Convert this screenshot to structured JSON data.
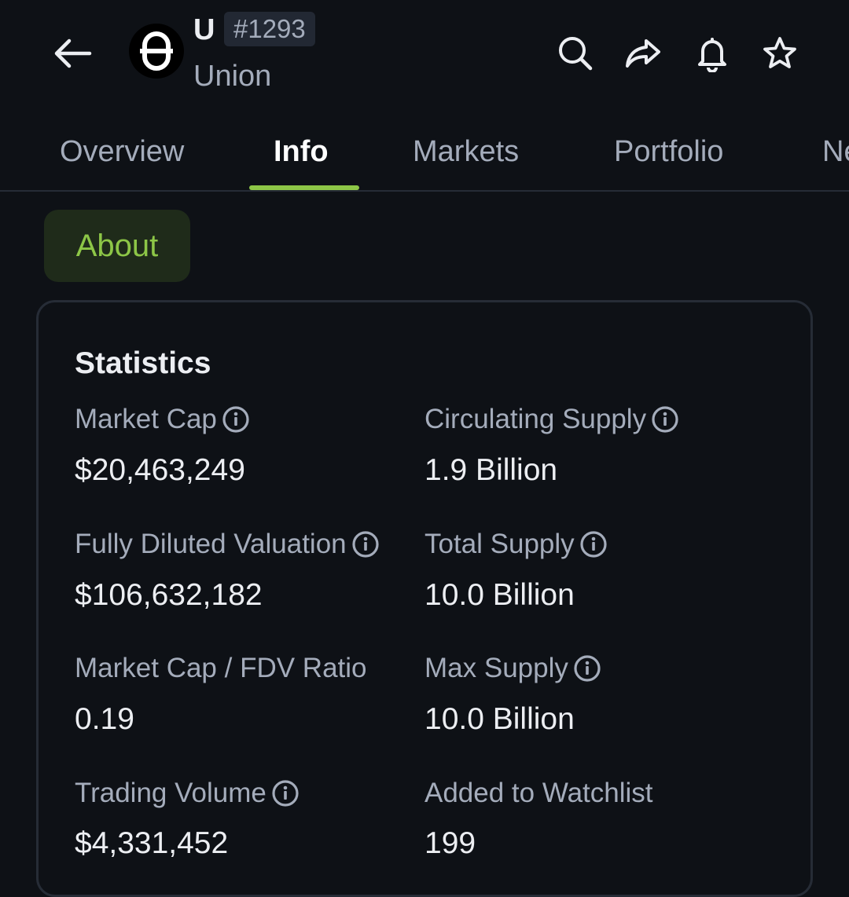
{
  "header": {
    "symbol": "U",
    "rank": "#1293",
    "name": "Union",
    "icons": [
      "back-arrow-icon",
      "search-icon",
      "share-icon",
      "bell-icon",
      "star-icon"
    ]
  },
  "tabs": [
    {
      "label": "Overview",
      "active": false
    },
    {
      "label": "Info",
      "active": true
    },
    {
      "label": "Markets",
      "active": false
    },
    {
      "label": "Portfolio",
      "active": false
    },
    {
      "label": "News",
      "active": false
    }
  ],
  "section_chip": "About",
  "statistics": {
    "title": "Statistics",
    "items": [
      {
        "label": "Market Cap",
        "value": "$20,463,249",
        "info": true
      },
      {
        "label": "Circulating Supply",
        "value": "1.9 Billion",
        "info": true
      },
      {
        "label": "Fully Diluted Valuation",
        "value": "$106,632,182",
        "info": true
      },
      {
        "label": "Total Supply",
        "value": "10.0 Billion",
        "info": true
      },
      {
        "label": "Market Cap / FDV Ratio",
        "value": "0.19",
        "info": false
      },
      {
        "label": "Max Supply",
        "value": "10.0 Billion",
        "info": true
      },
      {
        "label": "Trading Volume",
        "value": "$4,331,452",
        "info": true
      },
      {
        "label": "Added to Watchlist",
        "value": "199",
        "info": false
      }
    ]
  },
  "colors": {
    "background": "#0e1116",
    "accent": "#8dc647",
    "muted_text": "#a4acbb",
    "card_border": "#262c36"
  }
}
